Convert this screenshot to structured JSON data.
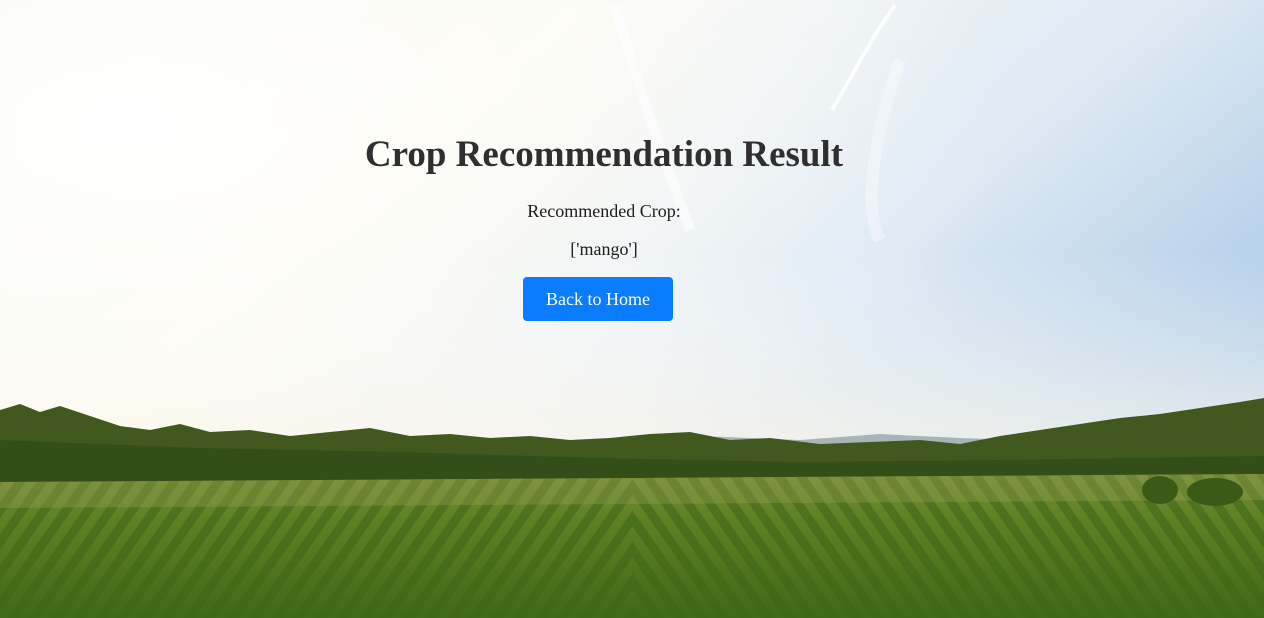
{
  "result": {
    "title": "Crop Recommendation Result",
    "label": "Recommended Crop:",
    "value": "['mango']"
  },
  "actions": {
    "back_label": "Back to Home"
  },
  "colors": {
    "button": "#0a7cff",
    "title": "#2f2f2f",
    "sky_top": "#a9c8e6",
    "field": "#5a7f22"
  }
}
